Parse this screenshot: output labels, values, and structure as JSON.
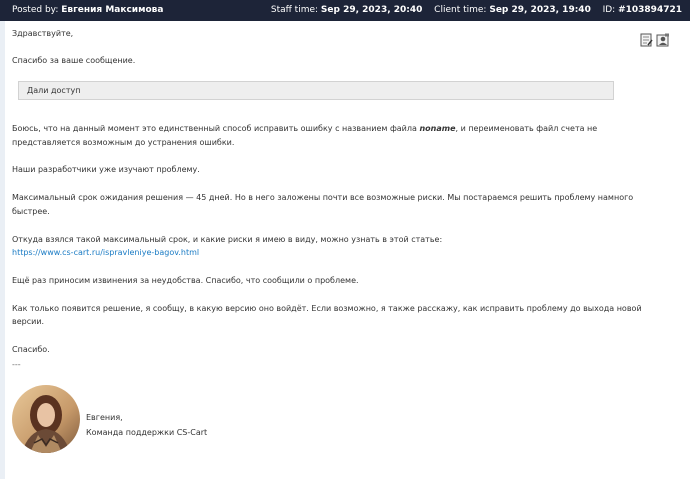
{
  "header": {
    "posted_by_label": "Posted by:",
    "posted_by_name": "Евгения Максимова",
    "staff_time_label": "Staff time:",
    "staff_time_value": "Sep 29, 2023, 20:40",
    "client_time_label": "Client time:",
    "client_time_value": "Sep 29, 2023, 19:40",
    "id_label": "ID:",
    "id_value": "#103894721"
  },
  "message": {
    "greeting": "Здравствуйте,",
    "thanks": "Спасибо за ваше сообщение.",
    "quote": "Дали доступ",
    "p1_part1": "Боюсь, что на данный момент это единственный способ исправить ошибку с названием файла ",
    "p1_bold": "noname",
    "p1_part2": ", и переименовать файл счета не",
    "p1_line2": "представляется возможным до устранения ошибки.",
    "p2": "Наши разработчики уже изучают проблему.",
    "p3_line1": "Максимальный срок ожидания решения — 45 дней. Но в него заложены почти все возможные риски. Мы постараемся решить проблему намного",
    "p3_line2": "быстрее.",
    "p4_line1": "Откуда взялся такой максимальный срок, и какие риски я имею в виду, можно узнать в этой статье:",
    "p4_link": "https://www.cs-cart.ru/ispravleniye-bagov.html",
    "p5": "Ещё раз приносим извинения за неудобства. Спасибо, что сообщили о проблеме.",
    "p6_line1": "Как только появится решение, я сообщу, в какую версию оно войдёт. Если возможно, я также расскажу, как исправить проблему до выхода новой",
    "p6_line2": "версии.",
    "closing": "Спасибо.",
    "separator": "---",
    "sig_name": "Евгения,",
    "sig_team": "Команда поддержки CS-Cart"
  },
  "icons": {
    "note": "note-edit-icon",
    "user": "user-card-icon"
  },
  "colors": {
    "header_bg": "#1d2438",
    "link": "#1a7bc4",
    "quote_bg": "#eeeeee"
  }
}
